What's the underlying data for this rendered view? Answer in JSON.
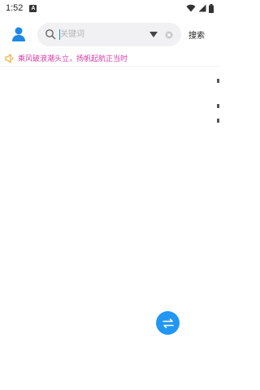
{
  "status_bar": {
    "time": "1:52",
    "notification_letter": "A"
  },
  "header": {
    "search_placeholder": "关键词",
    "search_button_label": "搜索"
  },
  "notice": {
    "text": "乘风破浪潮头立，扬帆起航正当时"
  },
  "colors": {
    "accent": "#2196f3",
    "notice_text": "#d63aa5",
    "notice_icon": "#f0a020",
    "search_bg": "#f1f1f3"
  },
  "icons": {
    "user": "person-icon",
    "search": "magnifier-icon",
    "dropdown": "triangle-down-icon",
    "clear": "close-circle-icon",
    "notice": "speaker-icon",
    "fab": "swap-arrows-icon"
  }
}
